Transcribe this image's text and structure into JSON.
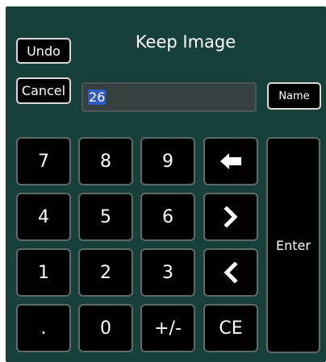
{
  "header": {
    "title": "Keep Image",
    "undo_label": "Undo",
    "cancel_label": "Cancel",
    "name_label": "Name"
  },
  "input": {
    "value": "26"
  },
  "keypad": {
    "keys": [
      "7",
      "8",
      "9",
      "4",
      "5",
      "6",
      "1",
      "2",
      "3",
      ".",
      "0",
      "+/-",
      "CE"
    ],
    "enter_label": "Enter",
    "nav_icons": [
      "backspace-icon",
      "chevron-right-icon",
      "chevron-left-icon"
    ]
  },
  "colors": {
    "panel_background": "#17403a",
    "button_background": "#000000",
    "field_background": "#35403f",
    "selection": "#2e59c9"
  }
}
